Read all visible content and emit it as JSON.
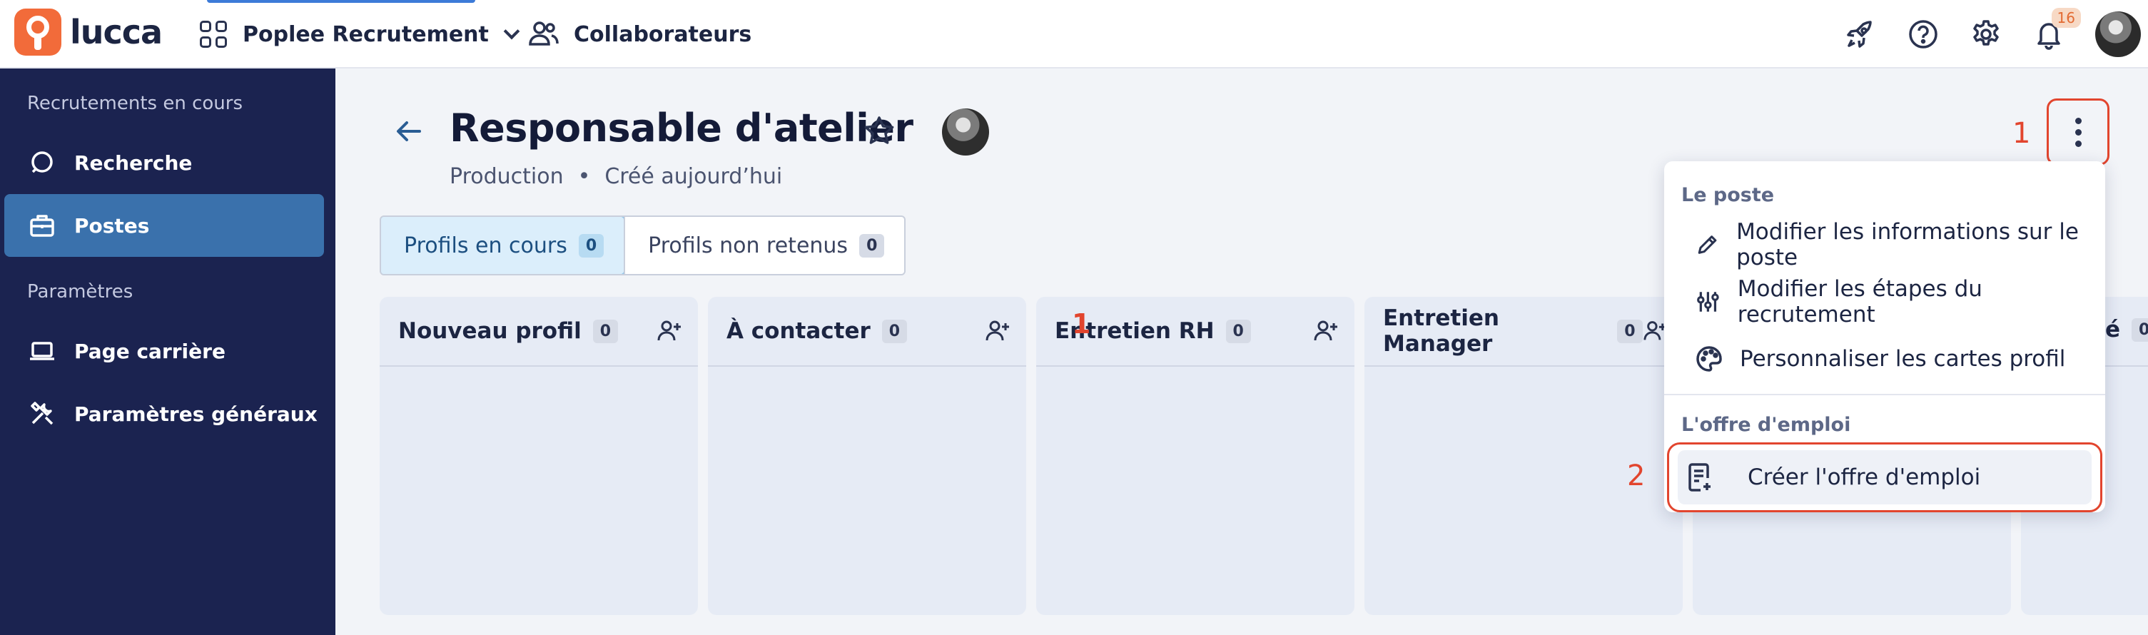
{
  "app": {
    "logo_text": "lucca"
  },
  "topbar": {
    "app_name": "Poplee Recrutement",
    "collaborators_label": "Collaborateurs",
    "notification_count": "16",
    "icons": [
      "rocket-icon",
      "help-icon",
      "gear-icon",
      "bell-icon",
      "avatar"
    ]
  },
  "sidebar": {
    "section_recruitments": "Recrutements en cours",
    "items_recruitments": [
      {
        "label": "Recherche",
        "icon": "search-icon"
      },
      {
        "label": "Postes",
        "icon": "briefcase-icon",
        "active": true
      }
    ],
    "section_settings": "Paramètres",
    "items_settings": [
      {
        "label": "Page carrière",
        "icon": "laptop-icon"
      },
      {
        "label": "Paramètres généraux",
        "icon": "tools-icon"
      }
    ]
  },
  "job": {
    "title": "Responsable d'atelier",
    "department": "Production",
    "separator": "•",
    "created": "Créé aujourd’hui"
  },
  "tabs": [
    {
      "label": "Profils en cours",
      "count": "0",
      "active": true
    },
    {
      "label": "Profils non retenus",
      "count": "0",
      "active": false
    }
  ],
  "columns": [
    {
      "title": "Nouveau profil",
      "count": "0"
    },
    {
      "title": "À contacter",
      "count": "0"
    },
    {
      "title": "Entretien RH",
      "count": "0"
    },
    {
      "title": "Entretien Manager",
      "count": "0"
    },
    {
      "title": "",
      "count": ""
    },
    {
      "title": "é",
      "count": "0"
    }
  ],
  "annotations": {
    "one": "1",
    "two": "2",
    "column_one": "1"
  },
  "menu": {
    "group_post": "Le poste",
    "items_post": [
      {
        "label": "Modifier les informations sur le poste",
        "icon": "pencil-icon"
      },
      {
        "label": "Modifier les étapes du recrutement",
        "icon": "sliders-icon"
      },
      {
        "label": "Personnaliser les cartes profil",
        "icon": "palette-icon"
      }
    ],
    "group_offer": "L'offre d'emploi",
    "items_offer": [
      {
        "label": "Créer l'offre d'emploi",
        "icon": "document-add-icon"
      }
    ]
  },
  "colors": {
    "accent": "#3a71ac",
    "sidebar": "#1b2350",
    "annotation": "#e2452e",
    "brand": "#f26b3a"
  }
}
